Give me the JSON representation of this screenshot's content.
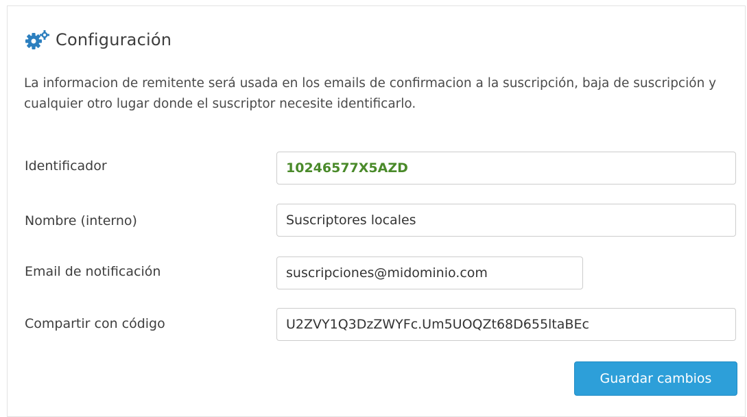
{
  "header": {
    "title": "Configuración",
    "icon": "gears-icon",
    "icon_color": "#2c7fbf"
  },
  "description": "La informacion de remitente será usada en los emails de confirmacion a la suscripción, baja de suscripción y cualquier otro lugar donde el suscriptor necesite identificarlo.",
  "form": {
    "identificador": {
      "label": "Identificador",
      "value": "10246577X5AZD",
      "value_color": "#4a8a2a"
    },
    "nombre": {
      "label": "Nombre (interno)",
      "value": "Suscriptores locales"
    },
    "email": {
      "label": "Email de notificación",
      "value": "suscripciones@midominio.com"
    },
    "compartir": {
      "label": "Compartir con código",
      "value": "U2ZVY1Q3DzZWYFc.Um5UOQZt68D655ltaBEc"
    }
  },
  "actions": {
    "save_label": "Guardar cambios",
    "save_color": "#2d9fd9"
  }
}
